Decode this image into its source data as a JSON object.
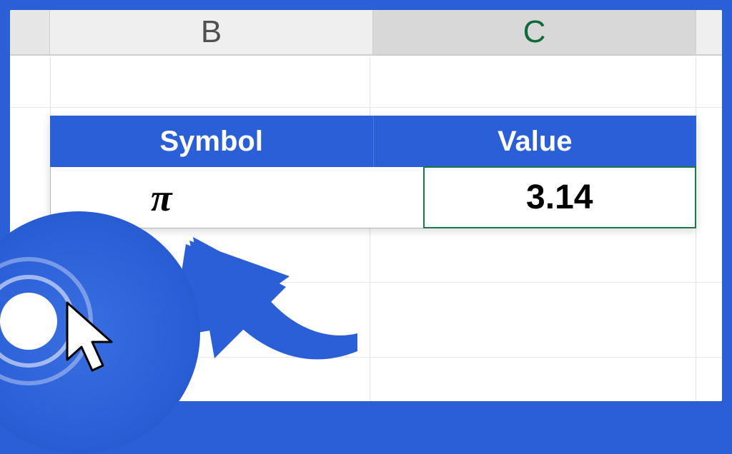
{
  "columns": {
    "b": "B",
    "c": "C"
  },
  "table": {
    "header_symbol": "Symbol",
    "header_value": "Value",
    "symbol": "π",
    "value": "3.14"
  },
  "icons": {
    "arrow": "curved-arrow-icon",
    "cursor": "cursor-click-icon"
  },
  "colors": {
    "brand_blue": "#2a5fd8",
    "excel_green": "#1a7a44"
  }
}
